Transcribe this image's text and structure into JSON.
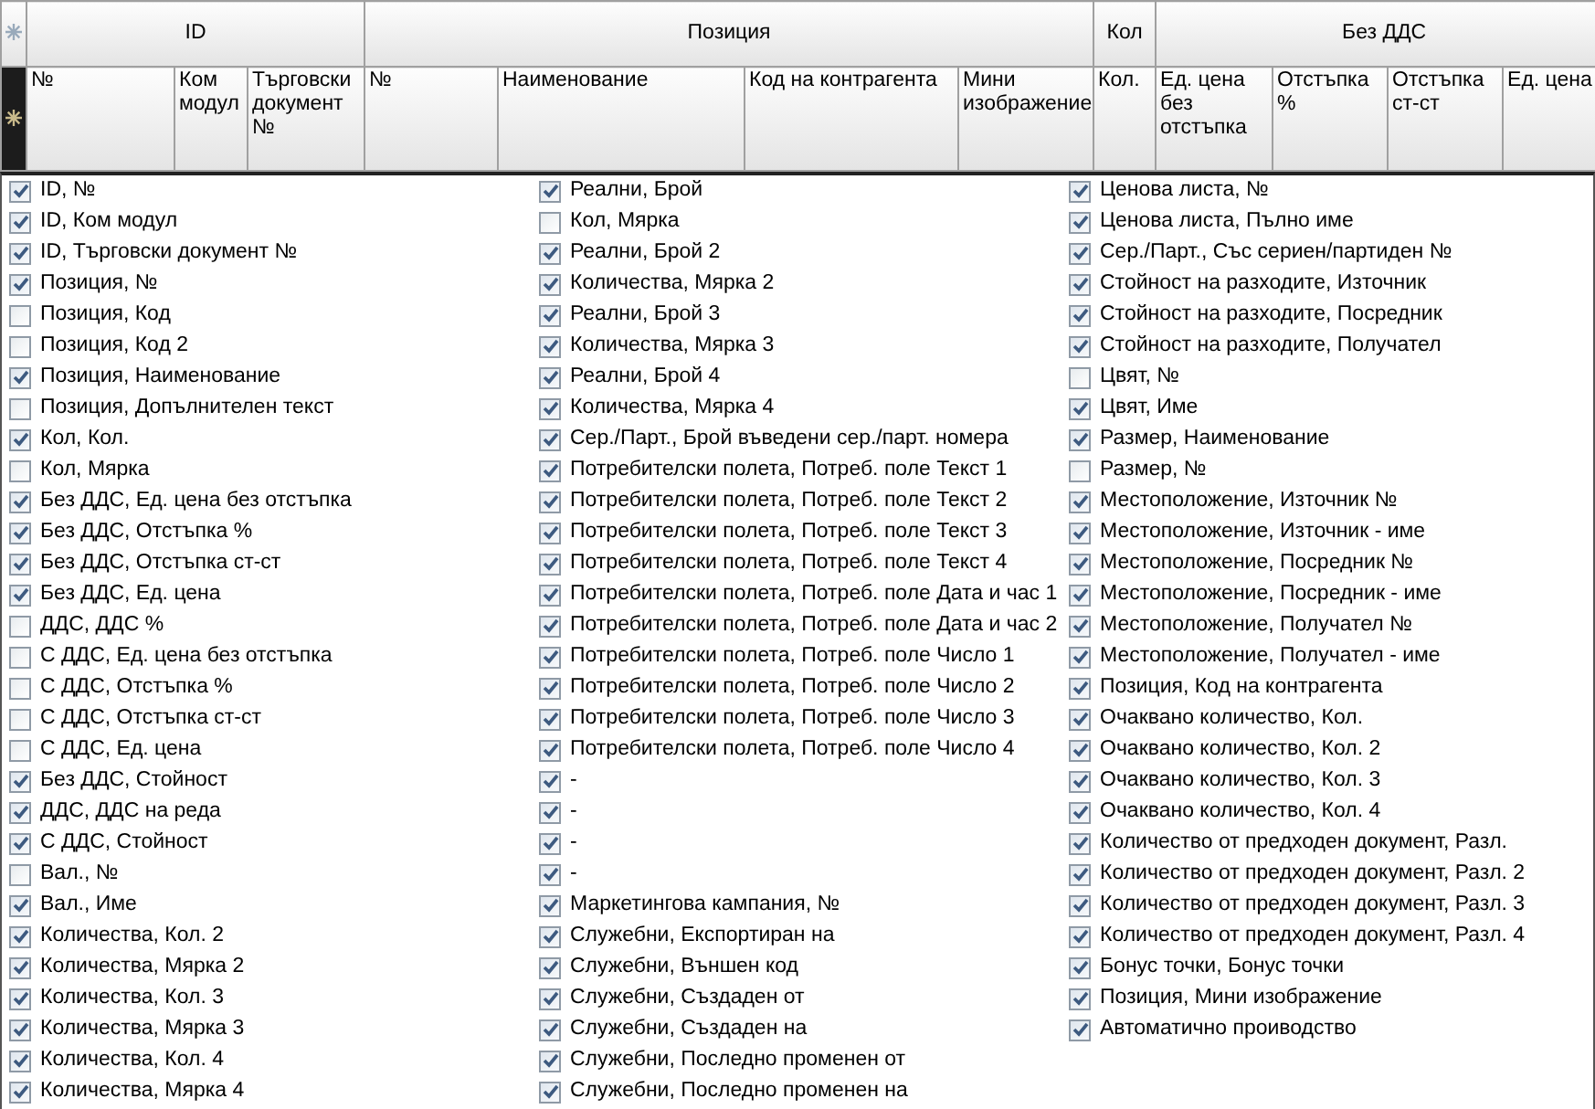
{
  "grid": {
    "column_groups": [
      {
        "label": "ID",
        "columns": [
          "№",
          "Ком модул",
          "Търговски документ №"
        ]
      },
      {
        "label": "Позиция",
        "columns": [
          "№",
          "Наименование",
          "Код на контрагента",
          "Мини изображение"
        ]
      },
      {
        "label": "Кол",
        "columns": [
          "Кол."
        ]
      },
      {
        "label": "Без ДДС",
        "columns": [
          "Ед. цена без отстъпка",
          "Отстъпка %",
          "Отстъпка ст-ст",
          "Ед. цена"
        ]
      }
    ]
  },
  "column_chooser": {
    "lists": [
      [
        {
          "label": "ID, №",
          "checked": true
        },
        {
          "label": "ID, Ком модул",
          "checked": true
        },
        {
          "label": "ID, Търговски документ №",
          "checked": true
        },
        {
          "label": "Позиция, №",
          "checked": true
        },
        {
          "label": "Позиция, Код",
          "checked": false
        },
        {
          "label": "Позиция, Код 2",
          "checked": false
        },
        {
          "label": "Позиция, Наименование",
          "checked": true
        },
        {
          "label": "Позиция, Допълнителен текст",
          "checked": false
        },
        {
          "label": "Кол, Кол.",
          "checked": true
        },
        {
          "label": "Кол, Мярка",
          "checked": false
        },
        {
          "label": "Без ДДС, Ед. цена без отстъпка",
          "checked": true
        },
        {
          "label": "Без ДДС, Отстъпка %",
          "checked": true
        },
        {
          "label": "Без ДДС, Отстъпка ст-ст",
          "checked": true
        },
        {
          "label": "Без ДДС, Ед. цена",
          "checked": true
        },
        {
          "label": "ДДС, ДДС %",
          "checked": false
        },
        {
          "label": "С ДДС, Ед. цена без отстъпка",
          "checked": false
        },
        {
          "label": "С ДДС, Отстъпка %",
          "checked": false
        },
        {
          "label": "С ДДС, Отстъпка ст-ст",
          "checked": false
        },
        {
          "label": "С ДДС, Ед. цена",
          "checked": false
        },
        {
          "label": "Без ДДС, Стойност",
          "checked": true
        },
        {
          "label": "ДДС, ДДС на реда",
          "checked": true
        },
        {
          "label": "С ДДС, Стойност",
          "checked": true
        },
        {
          "label": "Вал., №",
          "checked": false
        },
        {
          "label": "Вал., Име",
          "checked": true
        },
        {
          "label": "Количества, Кол. 2",
          "checked": true
        },
        {
          "label": "Количества, Мярка 2",
          "checked": true
        },
        {
          "label": "Количества, Кол. 3",
          "checked": true
        },
        {
          "label": "Количества, Мярка 3",
          "checked": true
        },
        {
          "label": "Количества, Кол. 4",
          "checked": true
        },
        {
          "label": "Количества, Мярка 4",
          "checked": true
        }
      ],
      [
        {
          "label": "Реални, Брой",
          "checked": true
        },
        {
          "label": "Кол, Мярка",
          "checked": false
        },
        {
          "label": "Реални, Брой 2",
          "checked": true
        },
        {
          "label": "Количества, Мярка 2",
          "checked": true
        },
        {
          "label": "Реални, Брой 3",
          "checked": true
        },
        {
          "label": "Количества, Мярка 3",
          "checked": true
        },
        {
          "label": "Реални, Брой 4",
          "checked": true
        },
        {
          "label": "Количества, Мярка 4",
          "checked": true
        },
        {
          "label": "Сер./Парт., Брой въведени сер./парт. номера",
          "checked": true
        },
        {
          "label": "Потребителски полета, Потреб. поле Текст 1",
          "checked": true
        },
        {
          "label": "Потребителски полета, Потреб. поле Текст 2",
          "checked": true
        },
        {
          "label": "Потребителски полета, Потреб. поле Текст 3",
          "checked": true
        },
        {
          "label": "Потребителски полета, Потреб. поле Текст 4",
          "checked": true
        },
        {
          "label": "Потребителски полета, Потреб. поле Дата и час 1",
          "checked": true
        },
        {
          "label": "Потребителски полета, Потреб. поле Дата и час 2",
          "checked": true
        },
        {
          "label": "Потребителски полета, Потреб. поле Число 1",
          "checked": true
        },
        {
          "label": "Потребителски полета, Потреб. поле Число 2",
          "checked": true
        },
        {
          "label": "Потребителски полета, Потреб. поле Число 3",
          "checked": true
        },
        {
          "label": "Потребителски полета, Потреб. поле Число 4",
          "checked": true
        },
        {
          "label": "-",
          "checked": true
        },
        {
          "label": "-",
          "checked": true
        },
        {
          "label": "-",
          "checked": true
        },
        {
          "label": "-",
          "checked": true
        },
        {
          "label": "Маркетингова кампания, №",
          "checked": true
        },
        {
          "label": "Служебни, Експортиран на",
          "checked": true
        },
        {
          "label": "Служебни, Външен код",
          "checked": true
        },
        {
          "label": "Служебни, Създаден от",
          "checked": true
        },
        {
          "label": "Служебни, Създаден на",
          "checked": true
        },
        {
          "label": "Служебни, Последно променен от",
          "checked": true
        },
        {
          "label": "Служебни, Последно променен на",
          "checked": true
        }
      ],
      [
        {
          "label": "Ценова листа, №",
          "checked": true
        },
        {
          "label": "Ценова листа, Пълно име",
          "checked": true
        },
        {
          "label": "Сер./Парт., Със сериен/партиден №",
          "checked": true
        },
        {
          "label": "Стойност на разходите, Източник",
          "checked": true
        },
        {
          "label": "Стойност на разходите, Посредник",
          "checked": true
        },
        {
          "label": "Стойност на разходите, Получател",
          "checked": true
        },
        {
          "label": "Цвят, №",
          "checked": false
        },
        {
          "label": "Цвят, Име",
          "checked": true
        },
        {
          "label": "Размер, Наименование",
          "checked": true
        },
        {
          "label": "Размер, №",
          "checked": false
        },
        {
          "label": "Местоположение, Източник №",
          "checked": true
        },
        {
          "label": "Местоположение, Източник - име",
          "checked": true
        },
        {
          "label": "Местоположение, Посредник №",
          "checked": true
        },
        {
          "label": "Местоположение, Посредник - име",
          "checked": true
        },
        {
          "label": "Местоположение, Получател №",
          "checked": true
        },
        {
          "label": "Местоположение, Получател - име",
          "checked": true
        },
        {
          "label": "Позиция, Код на контрагента",
          "checked": true
        },
        {
          "label": "Очаквано количество, Кол.",
          "checked": true
        },
        {
          "label": "Очаквано количество, Кол. 2",
          "checked": true
        },
        {
          "label": "Очаквано количество, Кол. 3",
          "checked": true
        },
        {
          "label": "Очаквано количество, Кол. 4",
          "checked": true
        },
        {
          "label": "Количество от предходен документ, Разл.",
          "checked": true
        },
        {
          "label": "Количество от предходен документ, Разл. 2",
          "checked": true
        },
        {
          "label": "Количество от предходен документ, Разл. 3",
          "checked": true
        },
        {
          "label": "Количество от предходен документ, Разл. 4",
          "checked": true
        },
        {
          "label": "Бонус точки, Бонус точки",
          "checked": true
        },
        {
          "label": "Позиция, Мини изображение",
          "checked": true
        },
        {
          "label": "Автоматично проиводство",
          "checked": true
        }
      ]
    ]
  }
}
